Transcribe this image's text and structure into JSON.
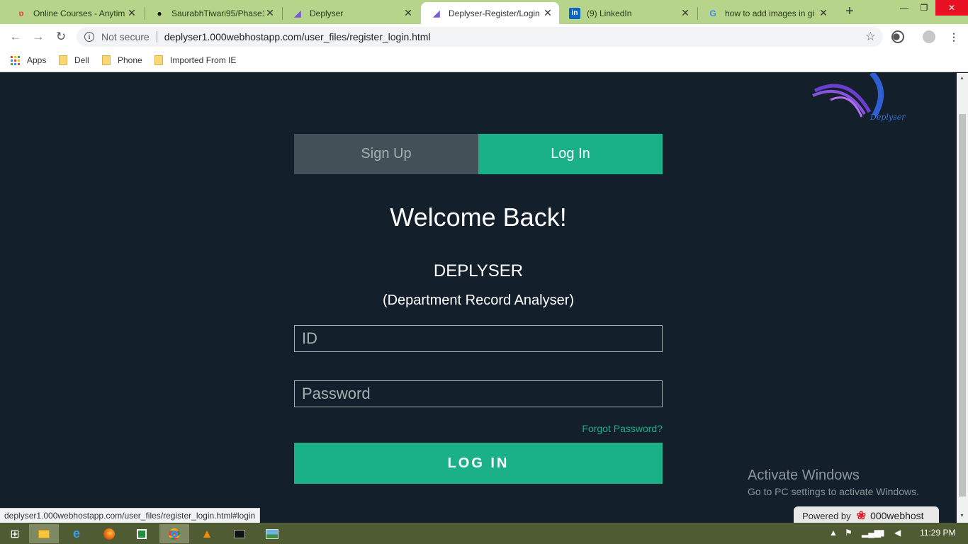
{
  "browser": {
    "tabs": [
      {
        "title": "Online Courses - Anytim",
        "icon": "udemy-icon",
        "icon_glyph": "ʋ",
        "active": false
      },
      {
        "title": "SaurabhTiwari95/Phase1",
        "icon": "github-icon",
        "icon_glyph": "●",
        "active": false
      },
      {
        "title": "Deplyser",
        "icon": "deplyser-icon",
        "icon_glyph": "◢",
        "active": false
      },
      {
        "title": "Deplyser-Register/Login",
        "icon": "deplyser-icon",
        "icon_glyph": "◢",
        "active": true
      },
      {
        "title": "(9) LinkedIn",
        "icon": "linkedin-icon",
        "icon_glyph": "in",
        "active": false
      },
      {
        "title": "how to add images in gi",
        "icon": "google-icon",
        "icon_glyph": "G",
        "active": false
      }
    ],
    "new_tab_glyph": "+",
    "window_controls": {
      "minimize": "—",
      "restore": "❐",
      "close": "✕"
    },
    "address_bar": {
      "security_label": "Not secure",
      "url": "deplyser1.000webhostapp.com/user_files/register_login.html"
    },
    "bookmarks": [
      {
        "label": "Apps",
        "icon": "apps-grid-icon"
      },
      {
        "label": "Dell",
        "icon": "folder-icon"
      },
      {
        "label": "Phone",
        "icon": "folder-icon"
      },
      {
        "label": "Imported From IE",
        "icon": "folder-icon"
      }
    ],
    "status_url": "deplyser1.000webhostapp.com/user_files/register_login.html#login"
  },
  "page": {
    "logo_text": "Deplyser",
    "tabs": {
      "signup": "Sign Up",
      "login": "Log In"
    },
    "heading": "Welcome Back!",
    "app_name": "DEPLYSER",
    "app_subtitle": "(Department Record Analyser)",
    "id_field": {
      "placeholder": "ID",
      "value": ""
    },
    "password_field": {
      "placeholder": "Password",
      "value": ""
    },
    "forgot_password": "Forgot Password?",
    "login_button": "LOG IN",
    "colors": {
      "background": "#13202c",
      "accent": "#1ab188",
      "inactive_tab": "#435057"
    }
  },
  "overlay": {
    "activate_title": "Activate Windows",
    "activate_subtitle": "Go to PC settings to activate Windows.",
    "powered_by": "Powered by",
    "powered_brand": "000webhost"
  },
  "taskbar": {
    "items": [
      "windows-start-icon",
      "file-explorer-icon",
      "internet-explorer-icon",
      "firefox-icon",
      "excel-icon",
      "chrome-icon",
      "vlc-icon",
      "cmd-icon",
      "image-viewer-icon"
    ],
    "clock": "11:29 PM"
  }
}
